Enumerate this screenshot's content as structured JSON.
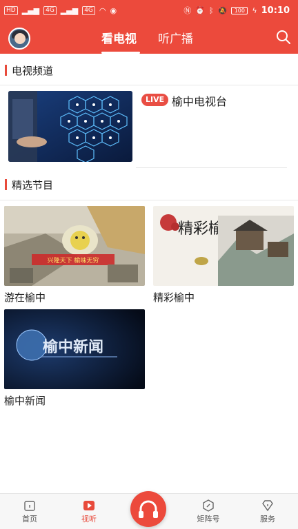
{
  "status_bar": {
    "left_chips": [
      "HD",
      "4G",
      "4G"
    ],
    "battery": "100",
    "time": "10:10"
  },
  "header": {
    "tabs": [
      {
        "label": "看电视",
        "active": true
      },
      {
        "label": "听广播",
        "active": false
      }
    ]
  },
  "tv_section": {
    "title": "电视频道",
    "channels": [
      {
        "live_badge": "LIVE",
        "name": "榆中电视台"
      }
    ]
  },
  "featured_section": {
    "title": "精选节目",
    "programs": [
      {
        "title": "游在榆中",
        "thumb_caption": "兴隆天下 榆味无穷"
      },
      {
        "title": "精彩榆中",
        "thumb_caption": "精彩榆中"
      },
      {
        "title": "榆中新闻",
        "thumb_caption": "榆中新闻"
      }
    ]
  },
  "bottom_nav": {
    "items": [
      {
        "label": "首页",
        "icon": "home-icon",
        "active": false
      },
      {
        "label": "视听",
        "icon": "play-icon",
        "active": true
      },
      {
        "label": "",
        "icon": "headphones-icon",
        "active": false
      },
      {
        "label": "矩阵号",
        "icon": "compass-icon",
        "active": false
      },
      {
        "label": "服务",
        "icon": "diamond-icon",
        "active": false
      }
    ]
  },
  "colors": {
    "brand_red": "#ec4a3c",
    "accent_red": "#e84a3b",
    "text": "#222222"
  }
}
